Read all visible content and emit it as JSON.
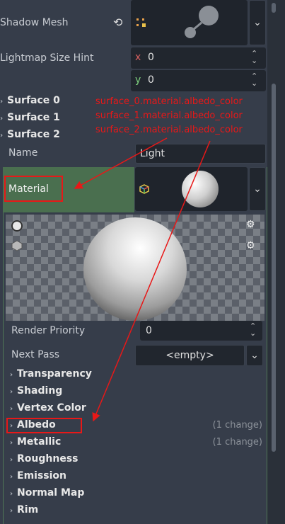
{
  "shadow_mesh": {
    "label": "Shadow Mesh"
  },
  "lightmap": {
    "label": "Lightmap Size Hint",
    "x_label": "x",
    "x_value": "0",
    "y_label": "y",
    "y_value": "0"
  },
  "surfaces": [
    {
      "label": "Surface 0",
      "annotation": "surface_0.material.albedo_color"
    },
    {
      "label": "Surface 1",
      "annotation": "surface_1.material.albedo_color"
    },
    {
      "label": "Surface 2",
      "annotation": "surface_2.material.albedo_color"
    }
  ],
  "name_row": {
    "label": "Name",
    "value": "Light"
  },
  "material_row": {
    "label": "Material"
  },
  "render_priority": {
    "label": "Render Priority",
    "value": "0"
  },
  "next_pass": {
    "label": "Next Pass",
    "value": "<empty>"
  },
  "sections": [
    {
      "label": "Transparency",
      "change": ""
    },
    {
      "label": "Shading",
      "change": ""
    },
    {
      "label": "Vertex Color",
      "change": ""
    },
    {
      "label": "Albedo",
      "change": "(1 change)"
    },
    {
      "label": "Metallic",
      "change": "(1 change)"
    },
    {
      "label": "Roughness",
      "change": ""
    },
    {
      "label": "Emission",
      "change": ""
    },
    {
      "label": "Normal Map",
      "change": ""
    },
    {
      "label": "Rim",
      "change": ""
    }
  ],
  "colors": {
    "annotation": "#e81818",
    "material_bg": "#4a6f4f",
    "panel": "#363d4a",
    "field": "#21262e"
  },
  "icons": [
    "reset-icon",
    "mesh-dots-icon",
    "chevron-down-icon",
    "spinner-icon",
    "material-cube-icon",
    "light-toggle-icon",
    "mesh-shape-icon",
    "gear-icon"
  ]
}
